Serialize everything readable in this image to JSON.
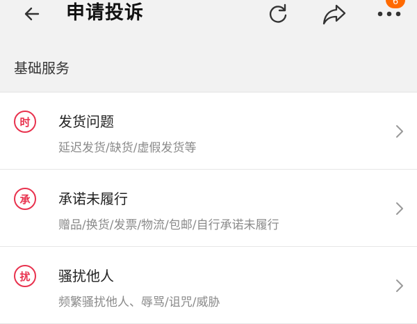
{
  "header": {
    "title": "申请投诉",
    "notification_count": "6",
    "icons": [
      "back-arrow-icon",
      "refresh-icon",
      "share-icon",
      "more-dots-icon"
    ]
  },
  "section": {
    "title": "基础服务"
  },
  "items": [
    {
      "badge": "时",
      "title": "发货问题",
      "subtitle": "延迟发货/缺货/虚假发货等"
    },
    {
      "badge": "承",
      "title": "承诺未履行",
      "subtitle": "赠品/换货/发票/物流/包邮/自行承诺未履行"
    },
    {
      "badge": "扰",
      "title": "骚扰他人",
      "subtitle": "频繁骚扰他人、辱骂/诅咒/威胁"
    }
  ],
  "colors": {
    "accent": "#e8314d",
    "badge": "#ff6a00",
    "background": "#f2f2f2"
  }
}
